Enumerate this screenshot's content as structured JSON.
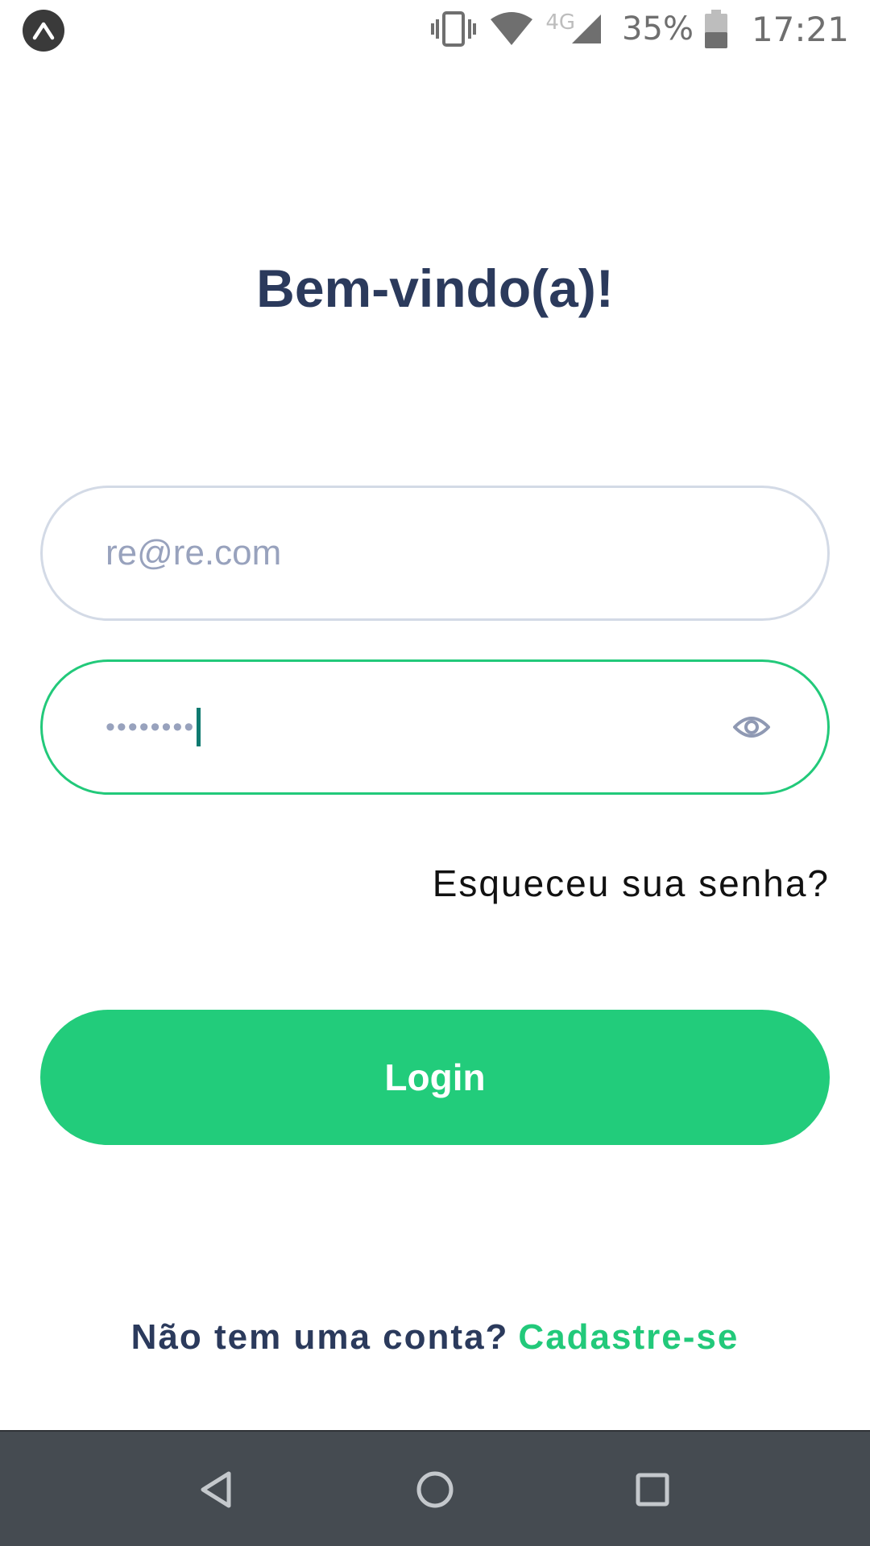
{
  "status_bar": {
    "app_icon": "expo-icon",
    "icons": [
      "vibrate-icon",
      "wifi-icon",
      "cellular-signal-icon",
      "battery-icon"
    ],
    "network_label": "4G",
    "battery_percent": "35%",
    "time": "17:21"
  },
  "login": {
    "title": "Bem-vindo(a)!",
    "email": {
      "value": "",
      "placeholder": "re@re.com"
    },
    "password": {
      "masked_value": "••••••••",
      "toggle_icon": "eye-icon"
    },
    "forgot_password_label": "Esqueceu sua senha?",
    "submit_label": "Login",
    "signup_prompt": "Não tem uma conta?",
    "signup_link": "Cadastre-se"
  },
  "nav_bar": {
    "buttons": [
      "back-icon",
      "home-icon",
      "recents-icon"
    ]
  },
  "colors": {
    "primary": "#22cc7b",
    "heading": "#2b3a5c",
    "placeholder": "#98a2bd",
    "border_default": "#d3dae6",
    "nav_bar": "#454b51"
  }
}
